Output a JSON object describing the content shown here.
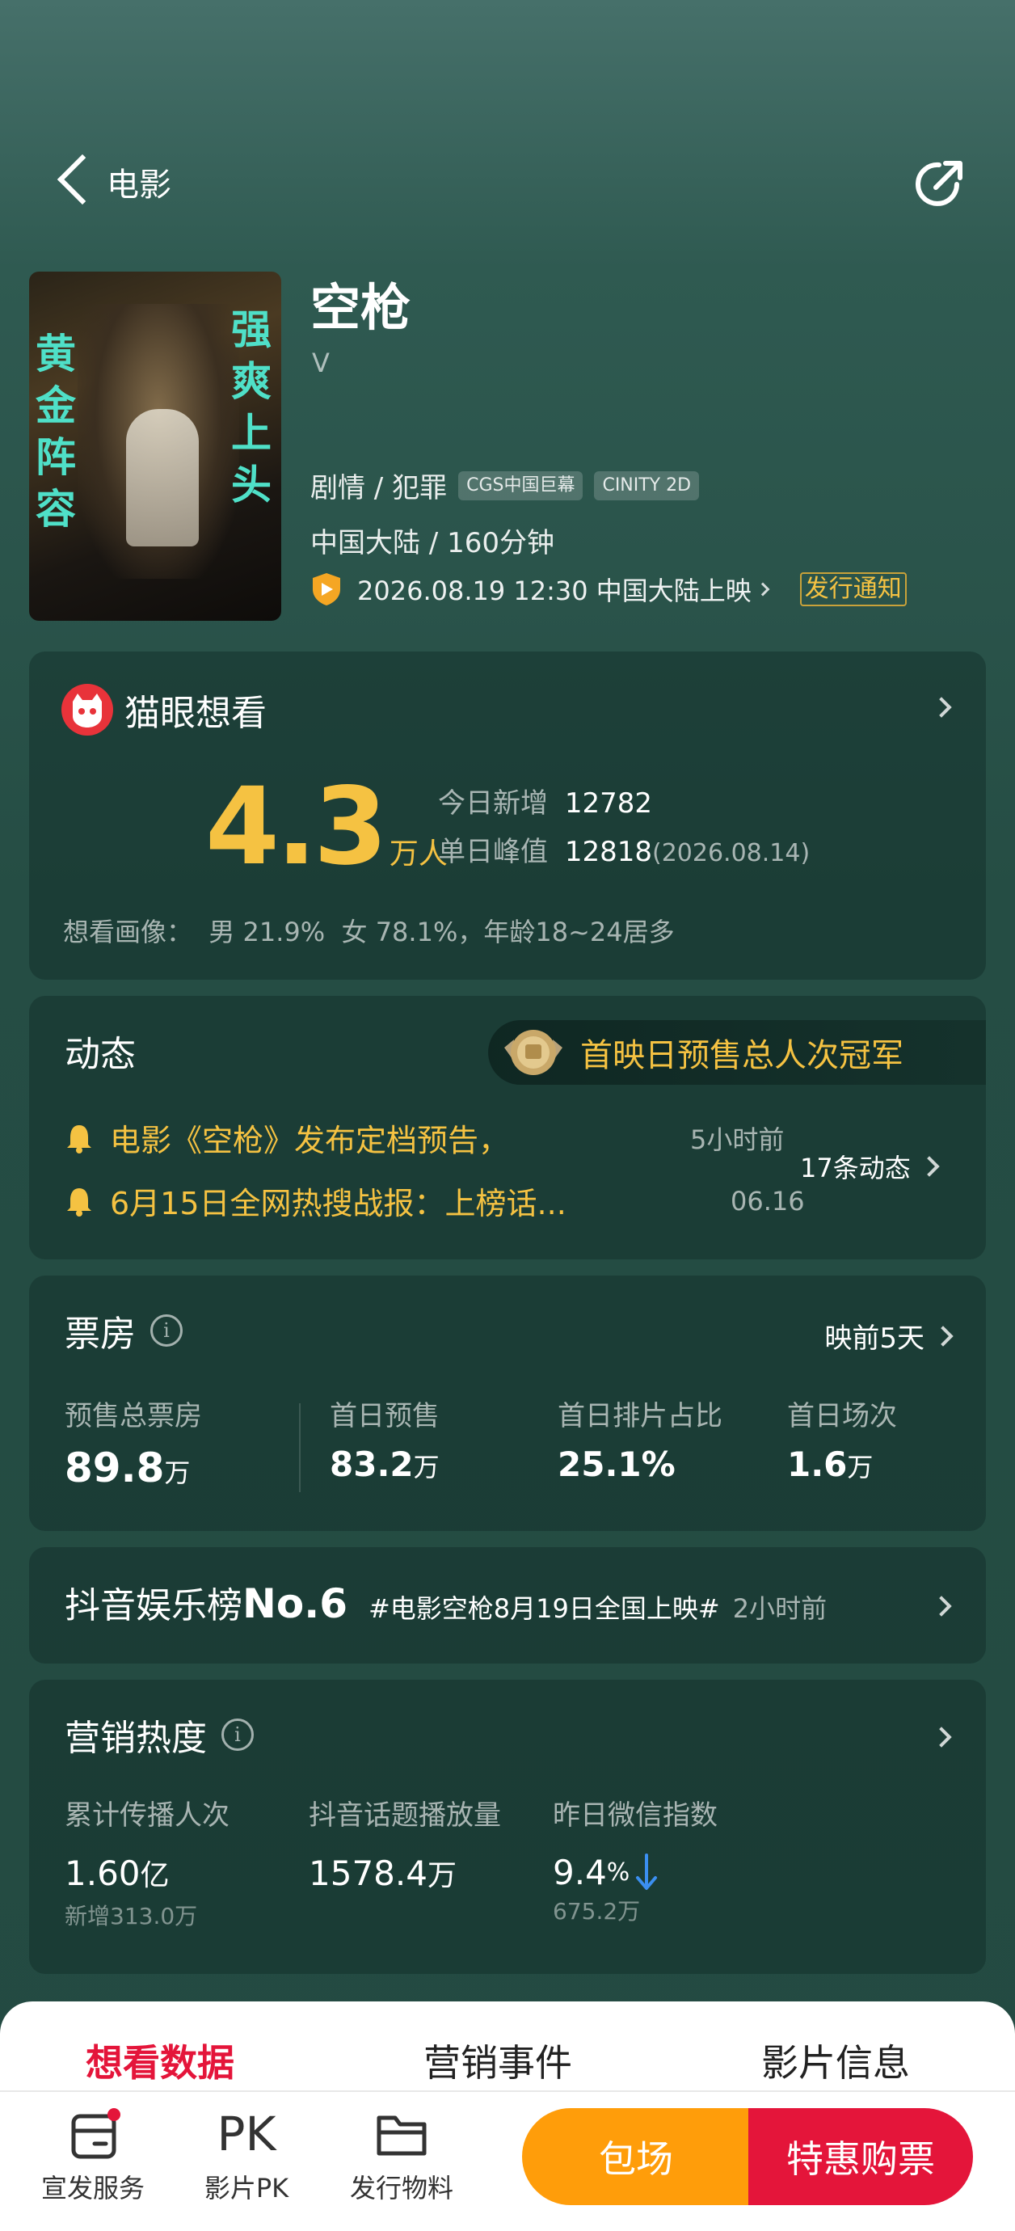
{
  "header": {
    "back_label": "电影"
  },
  "movie": {
    "title": "空枪",
    "subtitle": "V",
    "genres": "剧情 / 犯罪",
    "tags": [
      "CGS中国巨幕",
      "CINITY 2D"
    ],
    "region_duration": "中国大陆 / 160分钟",
    "release": "2026.08.19 12:30 中国大陆上映",
    "release_notice": "发行通知",
    "poster_text_left": "黄金阵容",
    "poster_text_right": "强爽上头"
  },
  "wish": {
    "title": "猫眼想看",
    "count": "4.3",
    "unit": "万人",
    "today_label": "今日新增",
    "today_value": "12782",
    "peak_label": "单日峰值",
    "peak_value": "12818",
    "peak_date": "(2026.08.14)",
    "portrait": "想看画像：  男 21.9%  女 78.1%，年龄18~24居多"
  },
  "dynamics": {
    "title": "动态",
    "badge": "首映日预售总人次冠军",
    "items": [
      {
        "text": "电影《空枪》发布定档预告，",
        "time": "5小时前"
      },
      {
        "text": "6月15日全网热搜战报：上榜话...",
        "time": "06.16"
      }
    ],
    "count_label": "17条动态"
  },
  "boxoffice": {
    "title": "票房",
    "days_label": "映前",
    "days_value": "5天",
    "stats": [
      {
        "label": "预售总票房",
        "value": "89.8",
        "unit": "万"
      },
      {
        "label": "首日预售",
        "value": "83.2",
        "unit": "万"
      },
      {
        "label": "首日排片占比",
        "value": "25.1%",
        "unit": ""
      },
      {
        "label": "首日场次",
        "value": "1.6",
        "unit": "万"
      }
    ]
  },
  "douyin": {
    "title": "抖音娱乐榜",
    "rank": "No.6",
    "topic": "#电影空枪8月19日全国上映#",
    "time": "2小时前"
  },
  "marketing": {
    "title": "营销热度",
    "stats": [
      {
        "label": "累计传播人次",
        "value": "1.60",
        "unit": "亿",
        "sub": "新增313.0万"
      },
      {
        "label": "抖音话题播放量",
        "value": "1578.4",
        "unit": "万",
        "sub": ""
      },
      {
        "label": "昨日微信指数",
        "value": "9.4",
        "unit": "%",
        "sub": "675.2万"
      }
    ]
  },
  "tabs": [
    "想看数据",
    "营销事件",
    "影片信息"
  ],
  "bottom": {
    "items": [
      {
        "label": "宣发服务"
      },
      {
        "label": "影片PK",
        "icon_text": "PK"
      },
      {
        "label": "发行物料"
      }
    ],
    "btn_private": "包场",
    "btn_buy": "特惠购票"
  },
  "colors": {
    "accent_red": "#e4153a",
    "accent_orange": "#ff9d0a",
    "gold": "#f5c242"
  }
}
